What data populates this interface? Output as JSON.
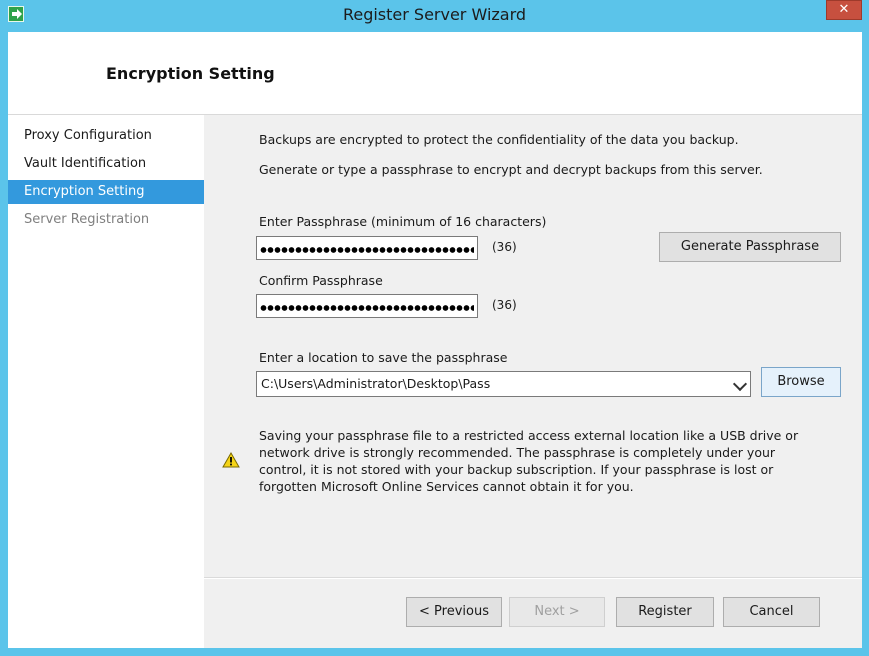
{
  "window": {
    "title": "Register Server Wizard",
    "close_label": "✕"
  },
  "header": {
    "title": "Encryption Setting"
  },
  "nav": {
    "items": [
      {
        "label": "Proxy Configuration"
      },
      {
        "label": "Vault Identification"
      },
      {
        "label": "Encryption Setting"
      },
      {
        "label": "Server Registration"
      }
    ]
  },
  "content": {
    "intro1": "Backups are encrypted to protect the confidentiality of the data you backup.",
    "intro2": "Generate or type a passphrase to encrypt and decrypt backups from this server.",
    "enter_label": "Enter Passphrase (minimum of 16 characters)",
    "enter_count": "(36)",
    "confirm_label": "Confirm Passphrase",
    "confirm_count": "(36)",
    "generate_button": "Generate Passphrase",
    "location_label": "Enter a location to save the passphrase",
    "location_value": "C:\\Users\\Administrator\\Desktop\\Pass",
    "browse_button": "Browse",
    "warning_text": "Saving your passphrase file to a restricted access external location like a USB drive or network drive is strongly recommended. The passphrase is completely under your control, it is not stored with your backup subscription. If your passphrase is lost or forgotten Microsoft Online Services cannot obtain it for you."
  },
  "footer": {
    "previous": "< Previous",
    "next": "Next >",
    "register": "Register",
    "cancel": "Cancel"
  },
  "colors": {
    "chrome": "#5bc4ea",
    "selected": "#3399dd",
    "close": "#c7503f"
  }
}
